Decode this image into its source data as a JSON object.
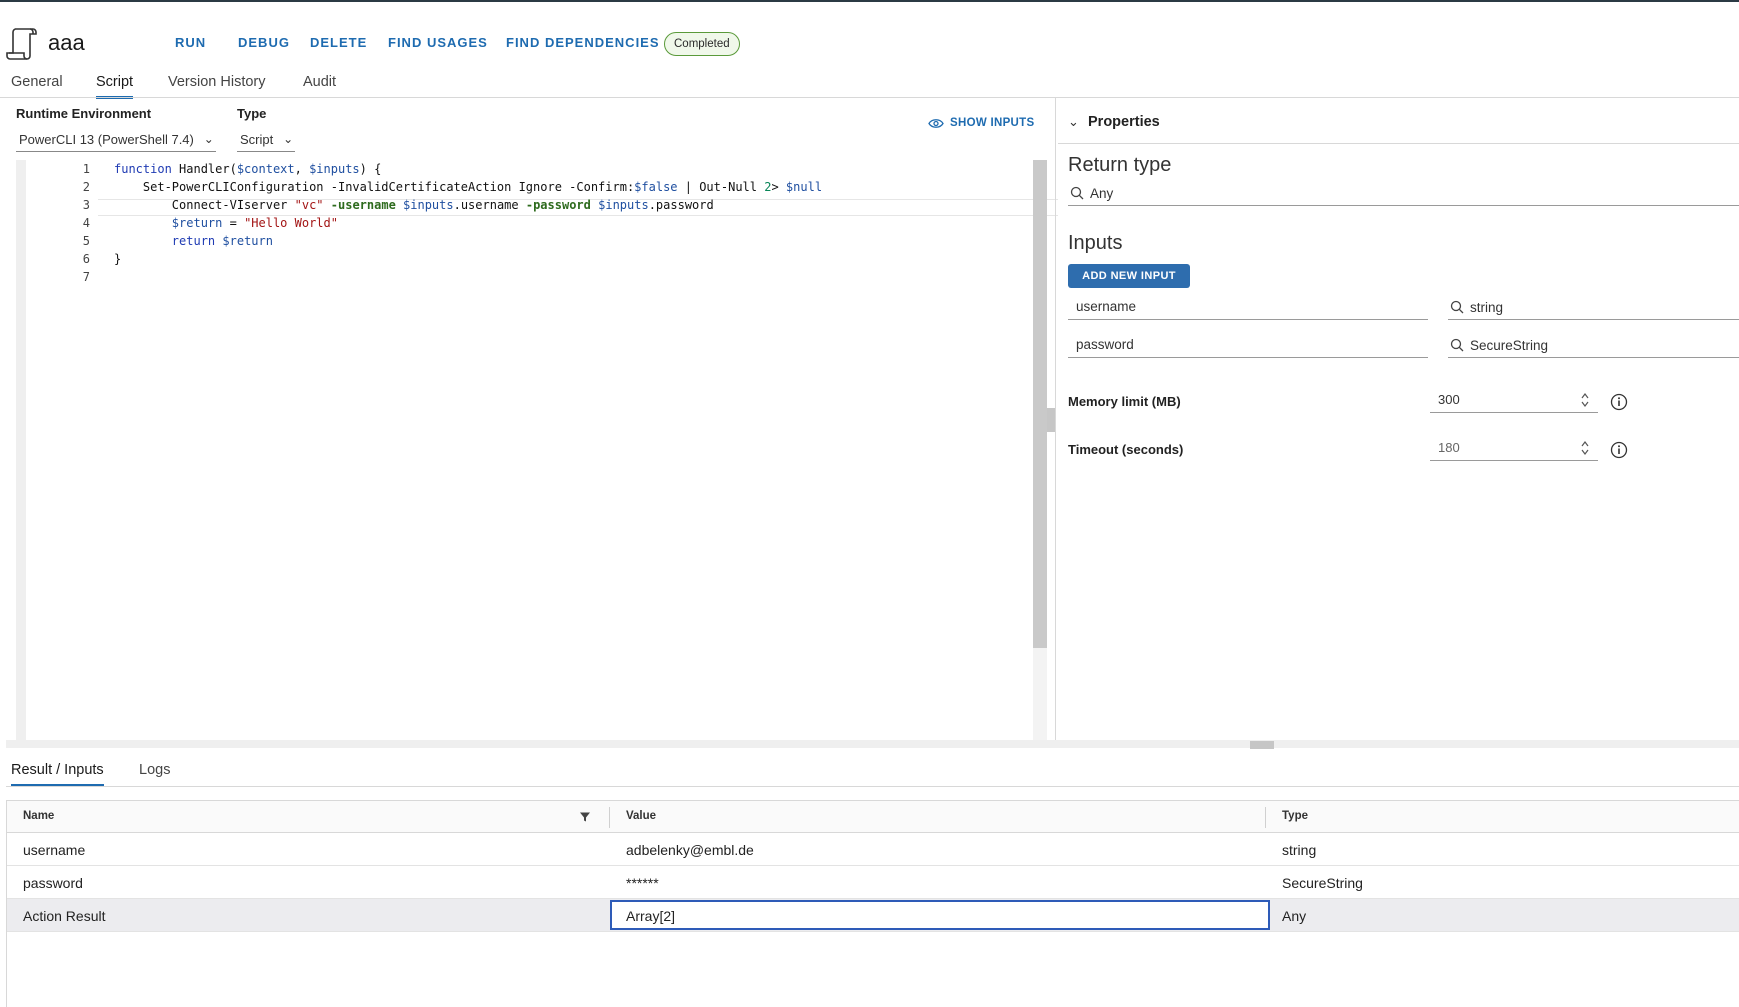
{
  "header": {
    "title": "aaa",
    "actions": {
      "run": "RUN",
      "debug": "DEBUG",
      "delete": "DELETE",
      "find_usages": "FIND USAGES",
      "find_dependencies": "FIND DEPENDENCIES"
    },
    "status": "Completed"
  },
  "tabs": [
    "General",
    "Script",
    "Version History",
    "Audit"
  ],
  "editor": {
    "runtime_label": "Runtime Environment",
    "runtime_value": "PowerCLI 13 (PowerShell 7.4)",
    "type_label": "Type",
    "type_value": "Script",
    "show_inputs": "SHOW INPUTS",
    "line_numbers": [
      "1",
      "2",
      "3",
      "4",
      "5",
      "6",
      "7"
    ]
  },
  "properties": {
    "title": "Properties",
    "return_type_title": "Return type",
    "return_type_value": "Any",
    "inputs_title": "Inputs",
    "add_input": "ADD NEW INPUT",
    "inputs": [
      {
        "name": "username",
        "type": "string"
      },
      {
        "name": "password",
        "type": "SecureString"
      }
    ],
    "memory_label": "Memory limit (MB)",
    "memory_value": "300",
    "timeout_label": "Timeout (seconds)",
    "timeout_value": "180"
  },
  "bottom": {
    "tabs": [
      "Result / Inputs",
      "Logs"
    ],
    "columns": [
      "Name",
      "Value",
      "Type"
    ],
    "rows": [
      {
        "name": "username",
        "value": "adbelenky@embl.de",
        "type": "string"
      },
      {
        "name": "password",
        "value": "******",
        "type": "SecureString"
      },
      {
        "name": "Action Result",
        "value": "Array[2]",
        "type": "Any"
      }
    ]
  },
  "colors": {
    "accent": "#1e6bb0",
    "status_border": "#5a9a3a",
    "selection": "#2e5bb8"
  }
}
